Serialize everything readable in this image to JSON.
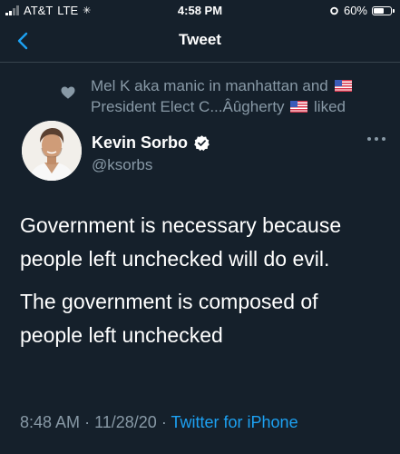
{
  "status_bar": {
    "carrier": "AT&T",
    "network": "LTE",
    "time": "4:58 PM",
    "battery_percent": "60%",
    "battery_level": 0.6
  },
  "nav": {
    "title": "Tweet",
    "back_icon": "chevron-left-icon"
  },
  "social_context": {
    "line1": "Mel K aka manic in manhattan and",
    "line2_before_flag": "President Elect C...Âûgherty",
    "line2_after_flag": "liked",
    "icon": "heart-icon"
  },
  "tweet": {
    "author_name": "Kevin Sorbo",
    "author_handle": "@ksorbs",
    "verified": true,
    "paragraphs": [
      "Government is necessary because people left unchecked will do evil.",
      "The government is composed of people left unchecked"
    ],
    "time": "8:48 AM",
    "date": "11/28/20",
    "separator": "·",
    "source": "Twitter for iPhone"
  },
  "colors": {
    "background": "#15202b",
    "secondary_text": "#8899a6",
    "accent": "#1da1f2",
    "divider": "#38444d"
  }
}
